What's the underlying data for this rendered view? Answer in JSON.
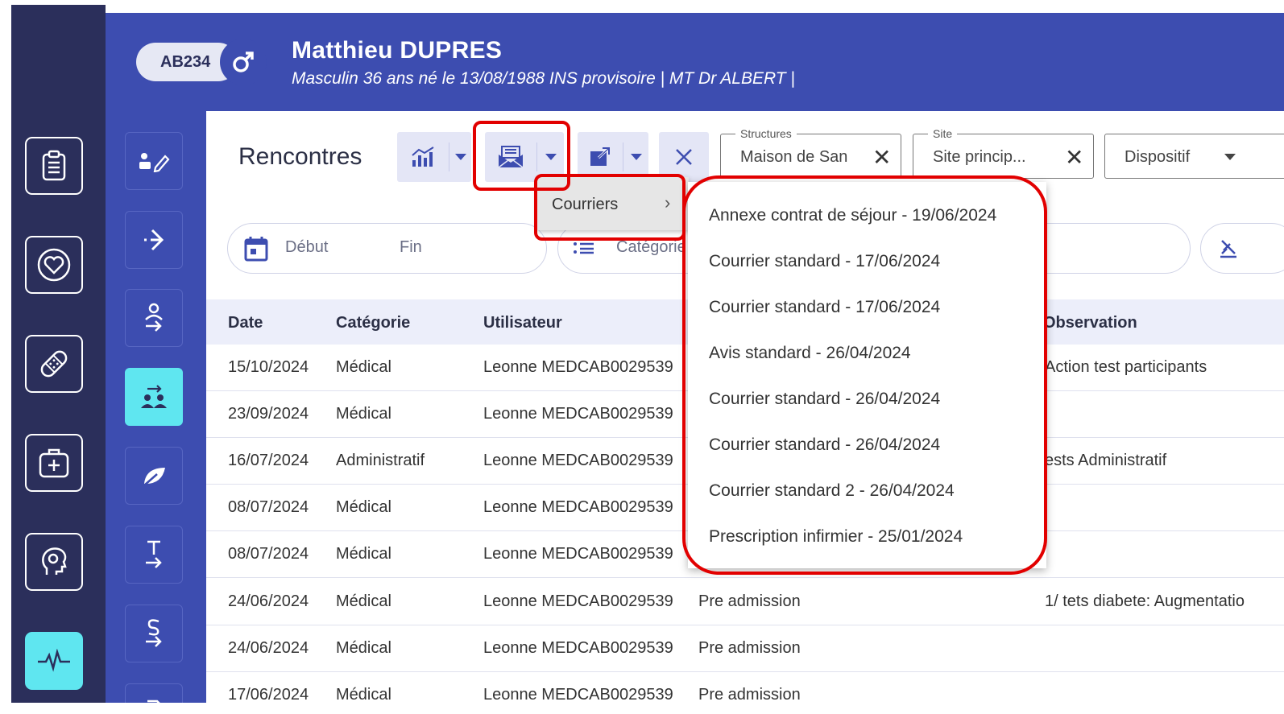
{
  "patient": {
    "id": "AB234",
    "name": "Matthieu DUPRES",
    "subtitle": "Masculin 36 ans né le 13/08/1988 INS provisoire | MT Dr ALBERT |"
  },
  "page_title": "Rencontres",
  "filters": {
    "structures": {
      "label": "Structures",
      "value": "Maison de San"
    },
    "site": {
      "label": "Site",
      "value": "Site princip..."
    },
    "dispositif": {
      "placeholder": "Dispositif"
    },
    "date_start": "Début",
    "date_end": "Fin",
    "categorie": "Catégorie"
  },
  "submenu": {
    "label": "Courriers"
  },
  "courriers": [
    "Annexe contrat de séjour - 19/06/2024",
    "Courrier standard - 17/06/2024",
    "Courrier standard - 17/06/2024",
    "Avis standard - 26/04/2024",
    "Courrier standard - 26/04/2024",
    "Courrier standard - 26/04/2024",
    "Courrier standard 2 - 26/04/2024",
    "Prescription infirmier - 25/01/2024"
  ],
  "table": {
    "headers": [
      "Date",
      "Catégorie",
      "Utilisateur",
      "Observation"
    ],
    "rows": [
      {
        "date": "15/10/2024",
        "cat": "Médical",
        "user": "Leonne MEDCAB0029539",
        "type": "",
        "obs": "Action test participants"
      },
      {
        "date": "23/09/2024",
        "cat": "Médical",
        "user": "Leonne MEDCAB0029539",
        "type": "",
        "obs": ""
      },
      {
        "date": "16/07/2024",
        "cat": "Administratif",
        "user": "Leonne MEDCAB0029539",
        "type": "",
        "obs": "ests Administratif"
      },
      {
        "date": "08/07/2024",
        "cat": "Médical",
        "user": "Leonne MEDCAB0029539",
        "type": "",
        "obs": ""
      },
      {
        "date": "08/07/2024",
        "cat": "Médical",
        "user": "Leonne MEDCAB0029539",
        "type": "",
        "obs": ""
      },
      {
        "date": "24/06/2024",
        "cat": "Médical",
        "user": "Leonne MEDCAB0029539",
        "type": "Pre admission",
        "obs": "1/ tets diabete: Augmentatio"
      },
      {
        "date": "24/06/2024",
        "cat": "Médical",
        "user": "Leonne MEDCAB0029539",
        "type": "Pre admission",
        "obs": ""
      },
      {
        "date": "17/06/2024",
        "cat": "Médical",
        "user": "Leonne MEDCAB0029539",
        "type": "Pre admission",
        "obs": ""
      }
    ]
  },
  "colors": {
    "header": "#3d4db0",
    "rail": "#2b2f5b",
    "accent": "#5fe6f0",
    "highlight": "#e20000"
  },
  "icons": {
    "rail1": [
      "clipboard-icon",
      "heart-icon",
      "bandage-icon",
      "medkit-icon",
      "head-icon",
      "pulse-icon"
    ],
    "rail2": [
      "user-edit-icon",
      "arrow-right-icon",
      "person-arrow-icon",
      "group-arrow-icon",
      "leaf-icon",
      "text-arrow-icon",
      "s-arrow-icon",
      "doc-icon"
    ]
  }
}
